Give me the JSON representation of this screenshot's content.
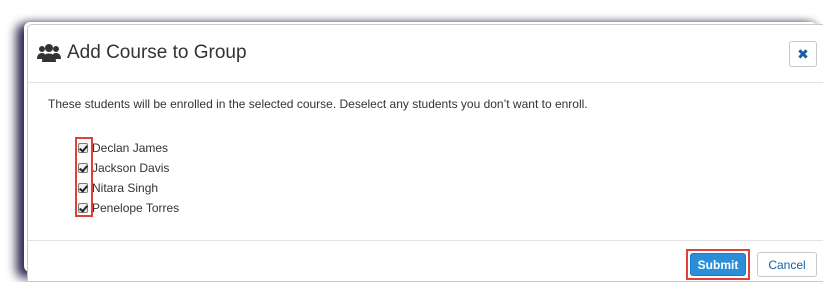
{
  "dialog": {
    "title": "Add Course to Group",
    "title_icon": "users-icon",
    "close_icon": "close-icon",
    "close_glyph": "✖",
    "instructions": "These students will be enrolled in the selected course. Deselect any students you don’t want to enroll."
  },
  "students": [
    {
      "name": "Declan James",
      "checked": true
    },
    {
      "name": "Jackson Davis",
      "checked": true
    },
    {
      "name": "Nitara Singh",
      "checked": true
    },
    {
      "name": "Penelope Torres",
      "checked": true
    }
  ],
  "footer": {
    "submit_label": "Submit",
    "cancel_label": "Cancel"
  },
  "colors": {
    "primary": "#2a8fd8",
    "link": "#1a5fa5",
    "highlight": "#e0403a"
  }
}
